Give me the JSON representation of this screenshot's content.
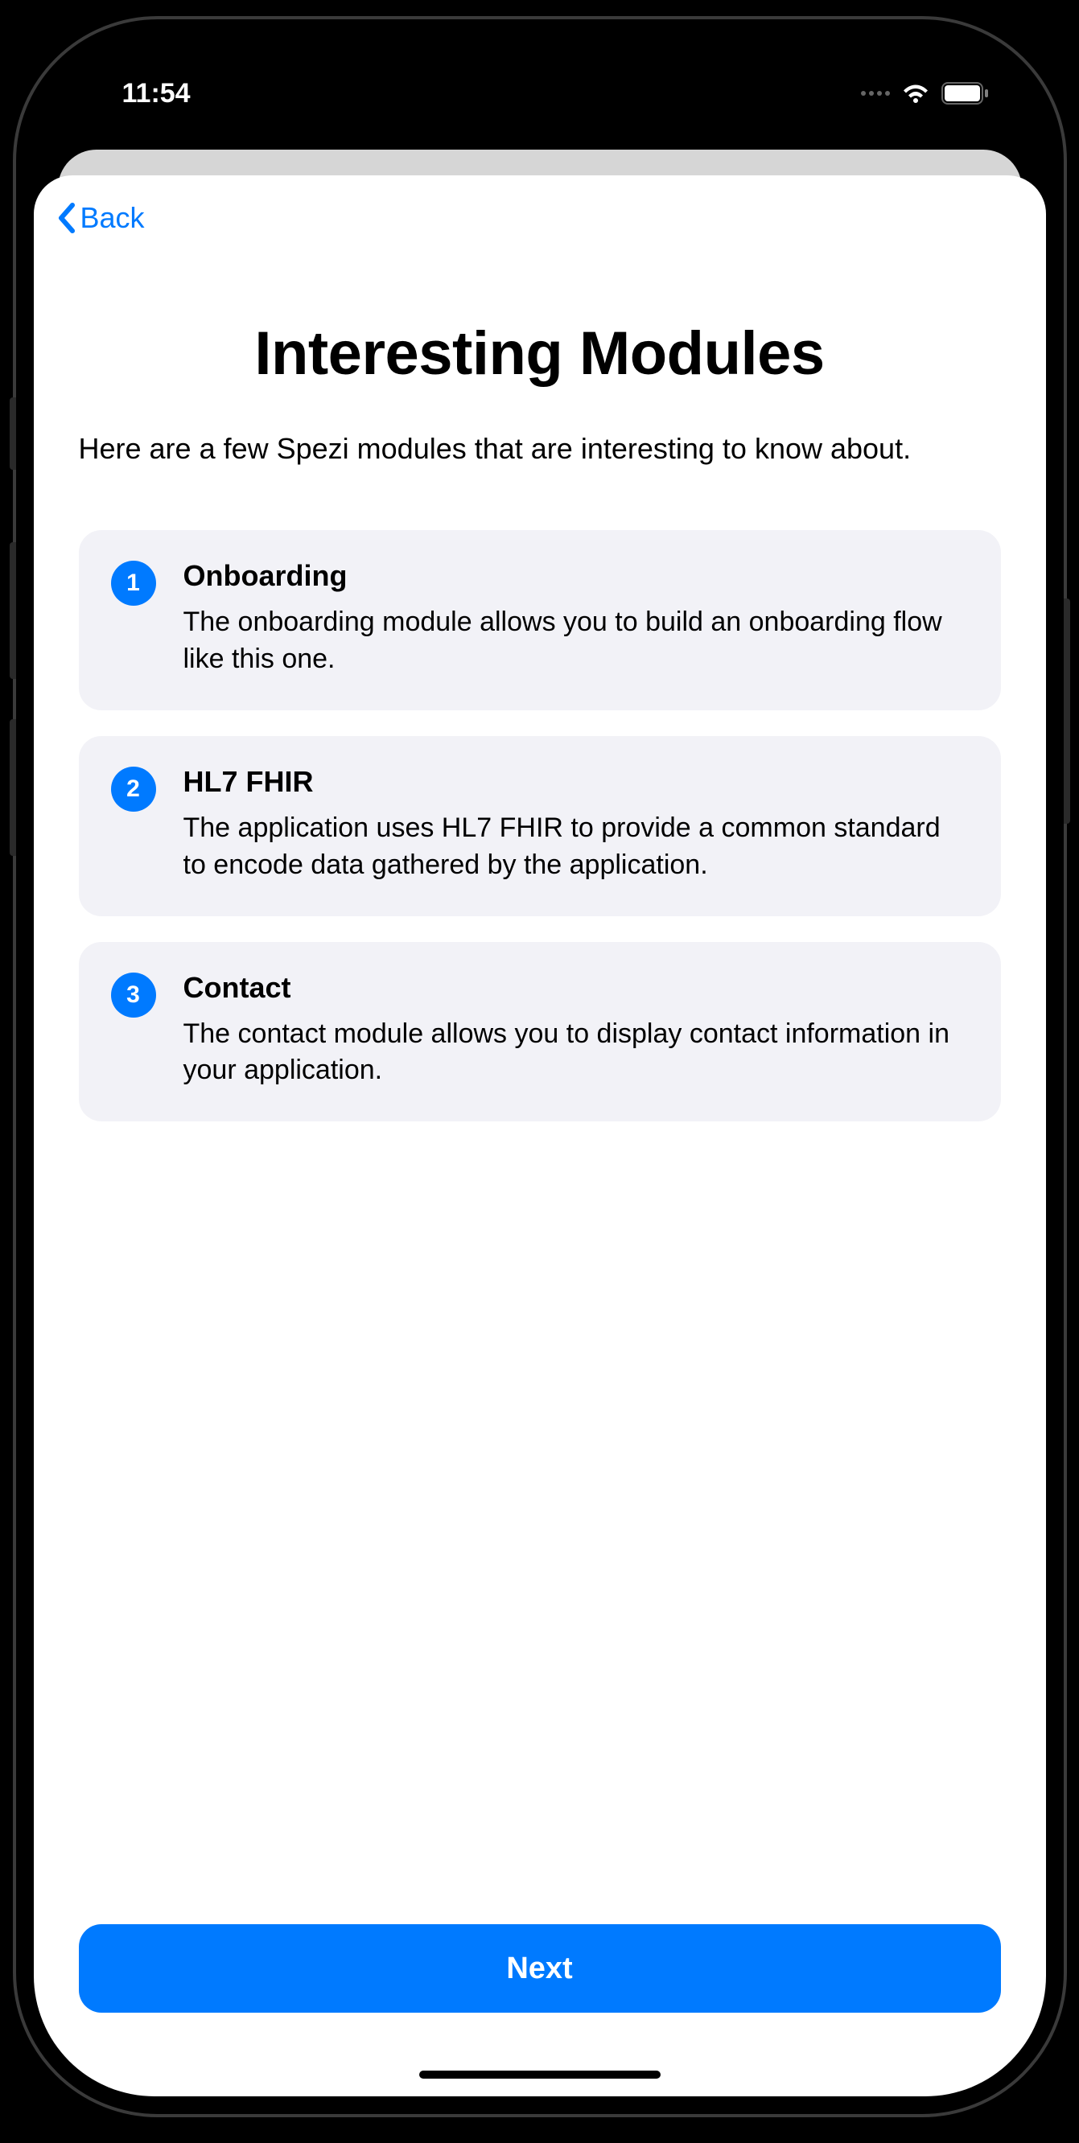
{
  "status_bar": {
    "time": "11:54"
  },
  "nav": {
    "back_label": "Back"
  },
  "header": {
    "title": "Interesting Modules",
    "subtitle": "Here are a few Spezi modules that are interesting to know about."
  },
  "modules": [
    {
      "index": "1",
      "title": "Onboarding",
      "description": "The onboarding module allows you to build an onboarding flow like this one."
    },
    {
      "index": "2",
      "title": "HL7 FHIR",
      "description": "The application uses HL7 FHIR to provide a common standard to encode data gathered by the application."
    },
    {
      "index": "3",
      "title": "Contact",
      "description": "The contact module allows you to display contact information in your application."
    }
  ],
  "footer": {
    "next_label": "Next"
  },
  "colors": {
    "accent": "#007aff",
    "card_bg": "#f2f2f7"
  }
}
